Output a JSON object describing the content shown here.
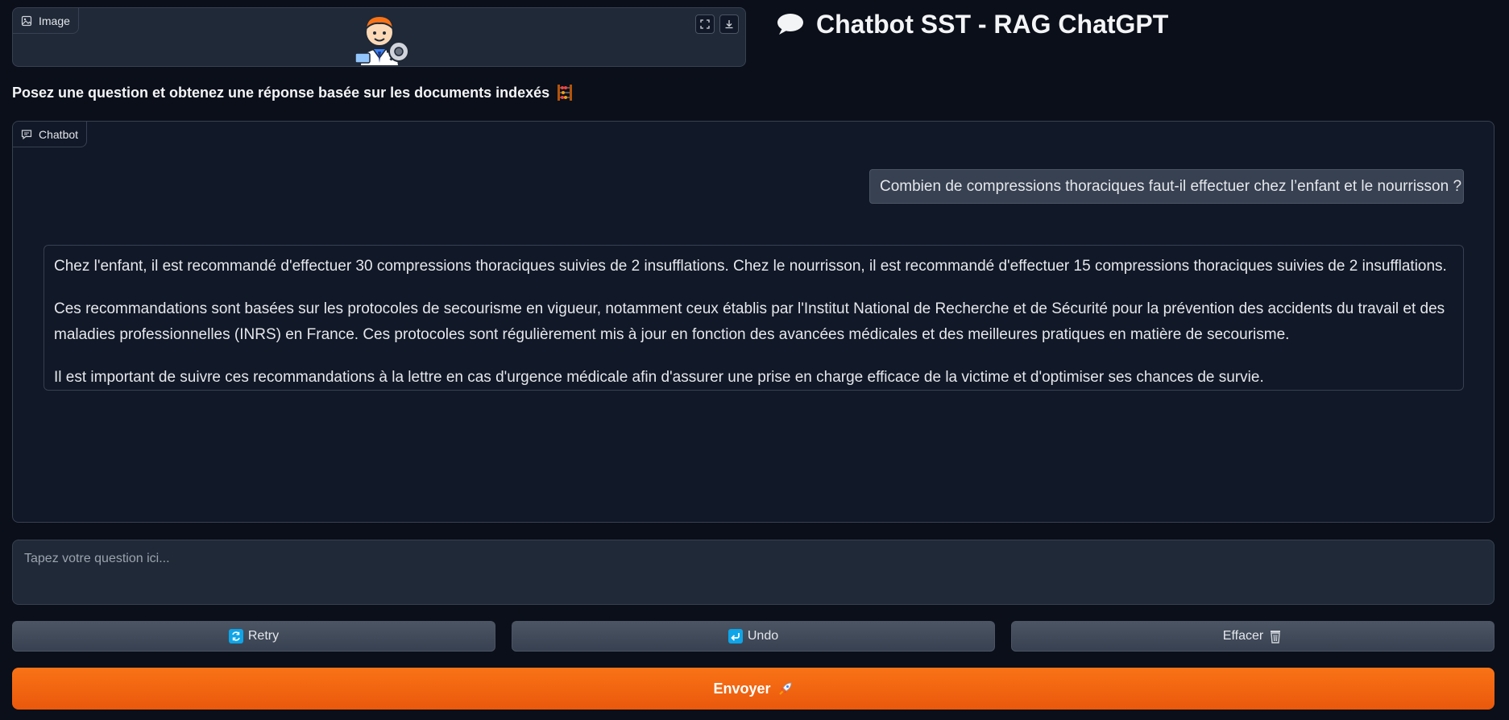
{
  "image_block": {
    "label": "Image",
    "icon": "image-icon",
    "avatar": "doctor-avatar-with-gear",
    "actions": [
      "fullscreen-icon",
      "download-icon"
    ]
  },
  "header": {
    "title": "Chatbot SST - RAG ChatGPT",
    "title_icon": "speech-bubble-icon"
  },
  "subtitle": {
    "text": "Posez une question et obtenez une réponse basée sur les documents indexés",
    "icon": "abacus-icon"
  },
  "chatbot": {
    "label": "Chatbot",
    "messages": [
      {
        "role": "user",
        "text": "Combien de compressions thoraciques faut-il effectuer chez l’enfant et le nourrisson ?"
      },
      {
        "role": "assistant",
        "paragraphs": [
          "Chez l'enfant, il est recommandé d'effectuer 30 compressions thoraciques suivies de 2 insufflations. Chez le nourrisson, il est recommandé d'effectuer 15 compressions thoraciques suivies de 2 insufflations.",
          "Ces recommandations sont basées sur les protocoles de secourisme en vigueur, notamment ceux établis par l'Institut National de Recherche et de Sécurité pour la prévention des accidents du travail et des maladies professionnelles (INRS) en France. Ces protocoles sont régulièrement mis à jour en fonction des avancées médicales et des meilleures pratiques en matière de secourisme.",
          "Il est important de suivre ces recommandations à la lettre en cas d'urgence médicale afin d'assurer une prise en charge efficace de la victime et d'optimiser ses chances de survie."
        ]
      }
    ]
  },
  "input": {
    "placeholder": "Tapez votre question ici...",
    "value": ""
  },
  "buttons": {
    "retry": "Retry",
    "undo": "Undo",
    "clear": "Effacer",
    "send": "Envoyer"
  },
  "colors": {
    "background": "#0b0f19",
    "panel": "#1f2937",
    "accent": "#f97316"
  }
}
